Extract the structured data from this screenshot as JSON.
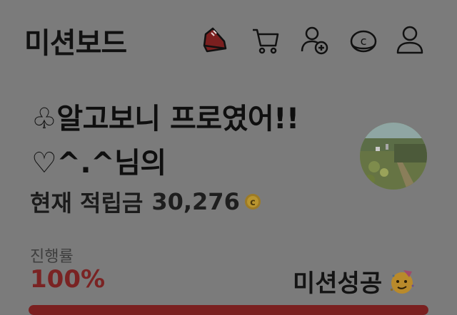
{
  "header": {
    "title": "미션보드",
    "icons": [
      "shoe-icon",
      "cart-icon",
      "add-user-icon",
      "coin-icon",
      "user-icon"
    ]
  },
  "mission": {
    "name_line1": "♧알고보니 프로였어!!",
    "name_line2": "♡^.^님의",
    "points_label": "현재 적립금",
    "points_value": "30,276",
    "progress_label": "진행률",
    "progress_value": "100%",
    "progress_fraction": 1.0,
    "status_label": "미션성공"
  },
  "colors": {
    "accent": "#7a2020",
    "coin": "#b08a2a"
  }
}
